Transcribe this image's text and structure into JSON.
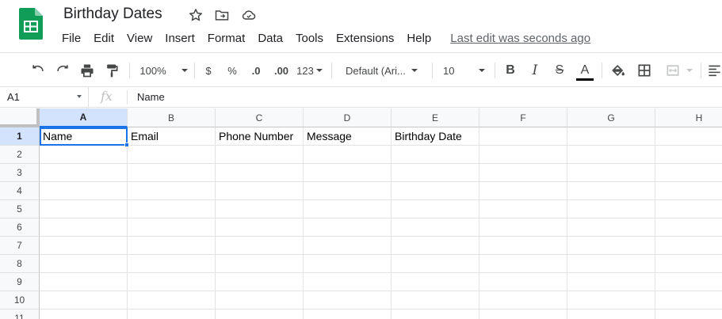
{
  "document": {
    "title": "Birthday Dates",
    "last_edit": "Last edit was seconds ago"
  },
  "menu": [
    "File",
    "Edit",
    "View",
    "Insert",
    "Format",
    "Data",
    "Tools",
    "Extensions",
    "Help"
  ],
  "toolbar": {
    "zoom": "100%",
    "currency": "$",
    "percent": "%",
    "decimal_decrease": ".0",
    "decimal_increase": ".00",
    "more_formats": "123",
    "font_family": "Default (Ari...",
    "font_size": "10",
    "bold": "B",
    "italic": "I",
    "strike": "S",
    "text_color_label": "A",
    "text_color": "#000000",
    "accent": "#1a73e8"
  },
  "formula_bar": {
    "name_box": "A1",
    "fx": "fx",
    "value": "Name"
  },
  "sheet": {
    "columns": [
      "A",
      "B",
      "C",
      "D",
      "E",
      "F",
      "G",
      "H"
    ],
    "rows": [
      "1",
      "2",
      "3",
      "4",
      "5",
      "6",
      "7",
      "8",
      "9",
      "10",
      "11"
    ],
    "cells": [
      [
        "Name",
        "Email",
        "Phone Number",
        "Message",
        "Birthday Date",
        "",
        "",
        ""
      ]
    ],
    "selected": "A1"
  },
  "icons": {
    "logo": "google-sheets-logo",
    "star": "star-icon",
    "move": "move-to-folder-icon",
    "cloud": "cloud-saved-icon"
  }
}
